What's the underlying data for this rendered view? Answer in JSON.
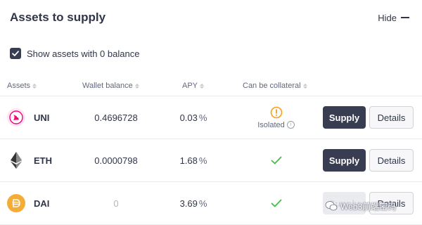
{
  "header": {
    "title": "Assets to supply",
    "hide_label": "Hide"
  },
  "show_zero": {
    "label": "Show assets with 0 balance",
    "checked": true
  },
  "table": {
    "columns": [
      "Assets",
      "Wallet balance",
      "APY",
      "Can be collateral"
    ],
    "rows": [
      {
        "asset": "UNI",
        "icon": "uni-token-icon",
        "balance": "0.4696728",
        "apy": "0.03",
        "apy_unit": "%",
        "collateral": "warning-icon",
        "collateral_note": "Isolated",
        "supply_label": "Supply",
        "details_label": "Details"
      },
      {
        "asset": "ETH",
        "icon": "eth-token-icon",
        "balance": "0.0000798",
        "apy": "1.68",
        "apy_unit": "%",
        "collateral": "check-icon",
        "supply_label": "Supply",
        "details_label": "Details"
      },
      {
        "asset": "DAI",
        "icon": "dai-token-icon",
        "balance": "0",
        "apy": "3.69",
        "apy_unit": "%",
        "collateral": "check-icon",
        "supply_label": "Supply",
        "details_label": "Details"
      }
    ]
  },
  "watermark": {
    "text": "Web3前端密码"
  },
  "colors": {
    "button_dark": "#383d51",
    "check_green": "#46bc4b",
    "warning_orange": "#f89f1a",
    "uni_pink": "#ff007a",
    "dai_yellow": "#f5ac37"
  }
}
